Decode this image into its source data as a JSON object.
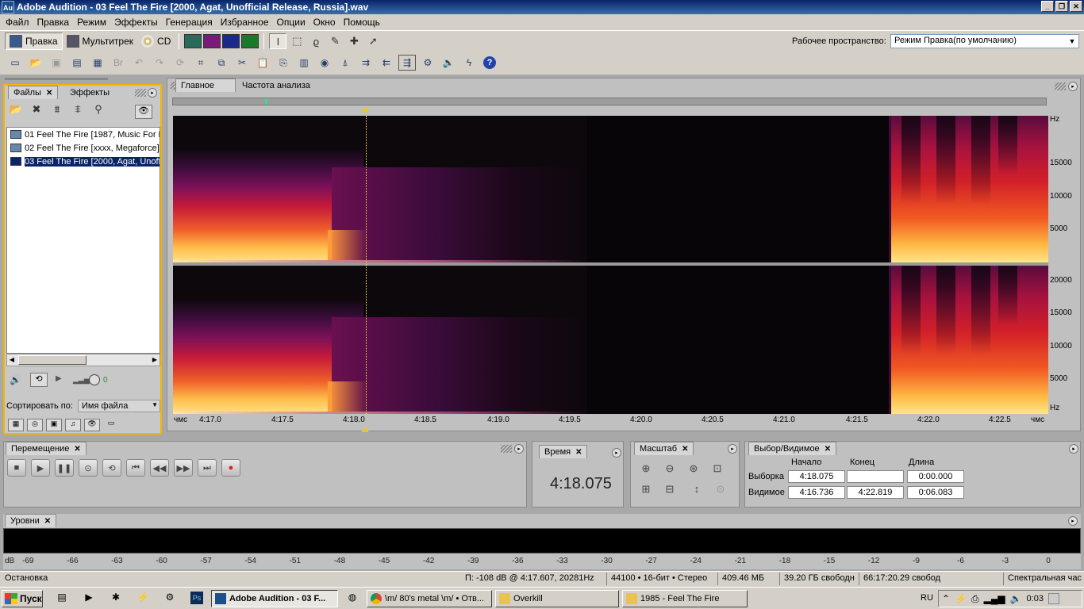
{
  "window": {
    "title": "Adobe Audition - 03 Feel The Fire [2000, Agat, Unofficial Release, Russia].wav",
    "app_icon": "Au"
  },
  "menu": [
    "Файл",
    "Правка",
    "Режим",
    "Эффекты",
    "Генерация",
    "Избранное",
    "Опции",
    "Окно",
    "Помощь"
  ],
  "modes": {
    "edit": "Правка",
    "multitrack": "Мультитрек",
    "cd": "CD"
  },
  "workspace": {
    "label": "Рабочее пространство:",
    "value": "Режим Правка(по умолчанию)"
  },
  "files_panel": {
    "tabs": [
      "Файлы",
      "Эффекты"
    ],
    "files": [
      "01 Feel The Fire [1987, Music For Nations]",
      "02 Feel The Fire [xxxx, Megaforce]",
      "03 Feel The Fire [2000, Agat, Unofficial Release, Russia]"
    ],
    "sort_label": "Сортировать по:",
    "sort_value": "Имя файла",
    "volume_value": "0"
  },
  "main_panel": {
    "tabs": [
      "Главное",
      "Частота анализа"
    ],
    "hz_top": [
      "Hz",
      "15000",
      "10000",
      "5000"
    ],
    "hz_bottom": [
      "20000",
      "15000",
      "10000",
      "5000",
      "Hz"
    ],
    "time_start": "чмс",
    "time_end": "чмс",
    "time_ticks": [
      "4:17.0",
      "4:17.5",
      "4:18.0",
      "4:18.5",
      "4:19.0",
      "4:19.5",
      "4:20.0",
      "4:20.5",
      "4:21.0",
      "4:21.5",
      "4:22.0",
      "4:22.5"
    ]
  },
  "transport": {
    "title": "Перемещение"
  },
  "time": {
    "title": "Время",
    "value": "4:18.075"
  },
  "zoom": {
    "title": "Масштаб"
  },
  "selection": {
    "title": "Выбор/Видимое",
    "col_start": "Начало",
    "col_end": "Конец",
    "col_length": "Длина",
    "row_selection": "Выборка",
    "row_view": "Видимое",
    "sel_start": "4:18.075",
    "sel_end": "",
    "sel_length": "0:00.000",
    "view_start": "4:16.736",
    "view_end": "4:22.819",
    "view_length": "0:06.083"
  },
  "levels": {
    "title": "Уровни",
    "scale": [
      "dB",
      "-69",
      "-66",
      "-63",
      "-60",
      "-57",
      "-54",
      "-51",
      "-48",
      "-45",
      "-42",
      "-39",
      "-36",
      "-33",
      "-30",
      "-27",
      "-24",
      "-21",
      "-18",
      "-15",
      "-12",
      "-9",
      "-6",
      "-3",
      "0"
    ]
  },
  "status": {
    "state": "Остановка",
    "cursor": "П: -108 dB @  4:17.607, 20281Hz",
    "format": "44100 • 16-бит • Стерео",
    "size": "409.46 МБ",
    "free": "39.20 ГБ свободн",
    "free_time": "66:17:20.29 свобод",
    "view": "Спектральная час"
  },
  "taskbar": {
    "start": "Пуск",
    "tasks": [
      "Adobe Audition - 03 F...",
      "\\m/ 80's metal \\m/ • Отв...",
      "Overkill",
      "1985 - Feel The Fire"
    ],
    "lang": "RU",
    "clock": "0:03"
  },
  "colors": {
    "accent_title": "#0a246a",
    "panel_highlight": "#f4b400",
    "spectrum_hot": "#ffe28a",
    "cursor": "#ffe04a"
  }
}
